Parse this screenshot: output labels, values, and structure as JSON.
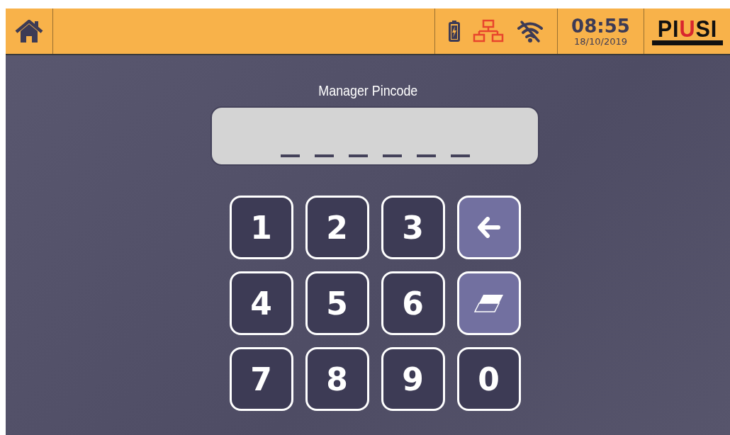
{
  "header": {
    "time": "08:55",
    "date": "18/10/2019",
    "network_alert": true,
    "wifi_connected": false,
    "logo_parts": [
      {
        "text": "PI",
        "color": "#111111"
      },
      {
        "text": "U",
        "color": "#d8262e"
      },
      {
        "text": "SI",
        "color": "#111111"
      }
    ]
  },
  "title": "Manager Pincode",
  "pin_slots": [
    {
      "filled": false
    },
    {
      "filled": false
    },
    {
      "filled": false
    },
    {
      "filled": false
    },
    {
      "filled": false
    },
    {
      "filled": false
    }
  ],
  "keys": [
    {
      "kind": "digit",
      "label": "1"
    },
    {
      "kind": "digit",
      "label": "2"
    },
    {
      "kind": "digit",
      "label": "3"
    },
    {
      "kind": "backspace"
    },
    {
      "kind": "digit",
      "label": "4"
    },
    {
      "kind": "digit",
      "label": "5"
    },
    {
      "kind": "digit",
      "label": "6"
    },
    {
      "kind": "clear"
    },
    {
      "kind": "digit",
      "label": "7"
    },
    {
      "kind": "digit",
      "label": "8"
    },
    {
      "kind": "digit",
      "label": "9"
    },
    {
      "kind": "digit",
      "label": "0"
    }
  ]
}
